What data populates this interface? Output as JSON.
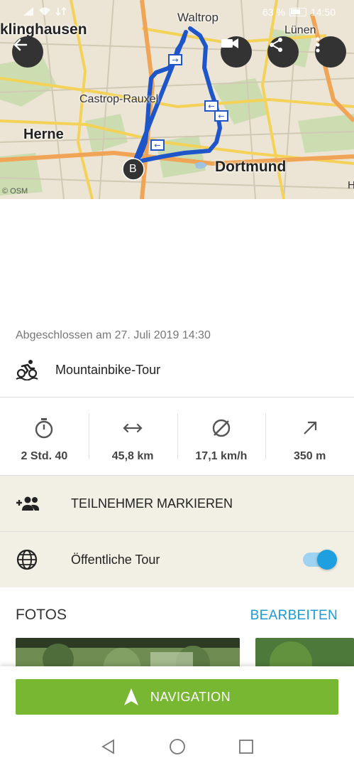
{
  "status_bar": {
    "battery": "63 %",
    "time": "14:50"
  },
  "map": {
    "labels": {
      "klinghausen": "klinghausen",
      "waltrop": "Waltrop",
      "luenen": "Lünen",
      "castrop": "Castrop-Rauxel",
      "herne": "Herne",
      "dortmund": "Dortmund"
    },
    "marker_label": "B",
    "attribution": "© OSM",
    "edge_letter": "H",
    "route_color": "#1e55c8"
  },
  "map_buttons": {
    "back": "back-arrow-icon",
    "video": "video-camera-icon",
    "share": "share-icon",
    "more": "more-vert-icon"
  },
  "tour": {
    "completed": "Abgeschlossen am 27. Juli 2019 14:30",
    "sport": "Mountainbike-Tour"
  },
  "stats": [
    {
      "icon": "stopwatch-icon",
      "value": "2 Std. 40"
    },
    {
      "icon": "distance-icon",
      "value": "45,8 km"
    },
    {
      "icon": "average-speed-icon",
      "value": "17,1 km/h"
    },
    {
      "icon": "uphill-icon",
      "value": "350 m"
    }
  ],
  "participants": {
    "label": "TEILNEHMER MARKIEREN"
  },
  "public_tour": {
    "label": "Öffentliche Tour",
    "enabled": true
  },
  "photos": {
    "title": "FOTOS",
    "edit": "BEARBEITEN"
  },
  "navigation": {
    "label": "NAVIGATION"
  },
  "colors": {
    "accent": "#77b732",
    "link": "#1e9ad6",
    "toggle": "#1e9fdf",
    "row_bg": "#f2f0e5"
  }
}
